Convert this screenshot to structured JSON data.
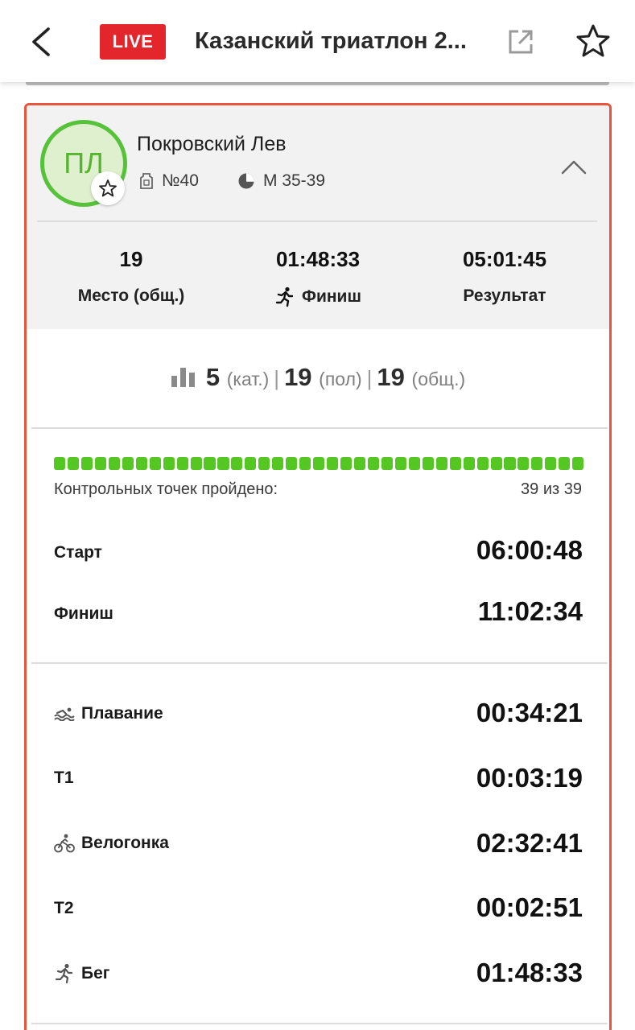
{
  "header": {
    "live_badge": "LIVE",
    "title": "Казанский триатлон 2...",
    "icons": [
      "back-arrow-icon",
      "external-link-icon",
      "star-outline-icon"
    ]
  },
  "athlete": {
    "initials": "ПЛ",
    "name": "Покровский Лев",
    "bib": "№40",
    "category": "М 35-39"
  },
  "summary": {
    "place": "19",
    "place_label": "Место (общ.)",
    "finish_time": "01:48:33",
    "finish_label": "Финиш",
    "result": "05:01:45",
    "result_label": "Результат"
  },
  "ranks": {
    "cat": "5",
    "cat_label": "(кат.)",
    "gender": "19",
    "gender_label": "(пол)",
    "overall": "19",
    "overall_label": "(общ.)"
  },
  "checkpoints": {
    "label": "Контрольных точек пройдено:",
    "value": "39 из 39",
    "passed": 39,
    "total": 39,
    "color": "#55c722"
  },
  "times": {
    "start_label": "Старт",
    "start": "06:00:48",
    "finish_label": "Финиш",
    "finish": "11:02:34"
  },
  "splits": [
    {
      "label": "Плавание",
      "time": "00:34:21",
      "icon": "swim-icon"
    },
    {
      "label": "T1",
      "time": "00:03:19",
      "icon": ""
    },
    {
      "label": "Велогонка",
      "time": "02:32:41",
      "icon": "bike-icon"
    },
    {
      "label": "T2",
      "time": "00:02:51",
      "icon": ""
    },
    {
      "label": "Бег",
      "time": "01:48:33",
      "icon": "run-icon"
    }
  ],
  "colors": {
    "live": "#e3262b",
    "card_border": "#e8553d",
    "avatar_ring": "#55c23a"
  }
}
